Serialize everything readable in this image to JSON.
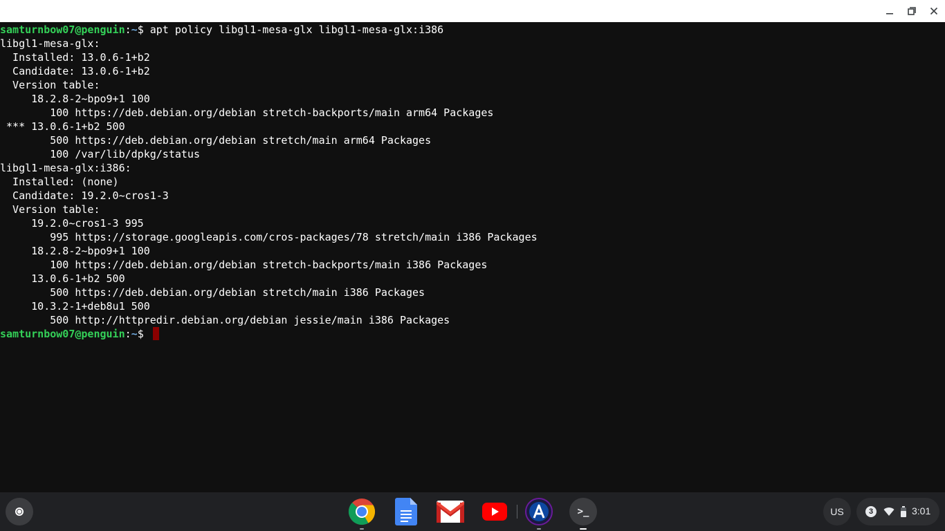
{
  "window": {
    "minimize_icon": "minimize-icon",
    "maximize_icon": "restore-icon",
    "close_icon": "close-icon"
  },
  "terminal": {
    "prompt": {
      "user": "samturnbow07@penguin",
      "sep": ":",
      "path": "~",
      "symbol": "$ "
    },
    "command": "apt policy libgl1-mesa-glx libgl1-mesa-glx:i386",
    "output": [
      "libgl1-mesa-glx:",
      "  Installed: 13.0.6-1+b2",
      "  Candidate: 13.0.6-1+b2",
      "  Version table:",
      "     18.2.8-2~bpo9+1 100",
      "        100 https://deb.debian.org/debian stretch-backports/main arm64 Packages",
      " *** 13.0.6-1+b2 500",
      "        500 https://deb.debian.org/debian stretch/main arm64 Packages",
      "        100 /var/lib/dpkg/status",
      "libgl1-mesa-glx:i386:",
      "  Installed: (none)",
      "  Candidate: 19.2.0~cros1-3",
      "  Version table:",
      "     19.2.0~cros1-3 995",
      "        995 https://storage.googleapis.com/cros-packages/78 stretch/main i386 Packages",
      "     18.2.8-2~bpo9+1 100",
      "        100 https://deb.debian.org/debian stretch-backports/main i386 Packages",
      "     13.0.6-1+b2 500",
      "        500 https://deb.debian.org/debian stretch/main i386 Packages",
      "     10.3.2-1+deb8u1 500",
      "        500 http://httpredir.debian.org/debian jessie/main i386 Packages"
    ]
  },
  "shelf": {
    "launcher_icon": "launcher-icon",
    "apps": [
      {
        "name": "Chrome",
        "icon": "chrome-icon"
      },
      {
        "name": "Docs",
        "icon": "docs-icon"
      },
      {
        "name": "Gmail",
        "icon": "gmail-icon"
      },
      {
        "name": "YouTube",
        "icon": "youtube-icon"
      },
      {
        "name": "Arc",
        "icon": "arc-icon"
      },
      {
        "name": "Terminal",
        "icon": "terminal-icon",
        "glyph": ">_"
      }
    ],
    "ime": "US",
    "tray": {
      "notification_count": "3",
      "time": "3:01"
    }
  }
}
